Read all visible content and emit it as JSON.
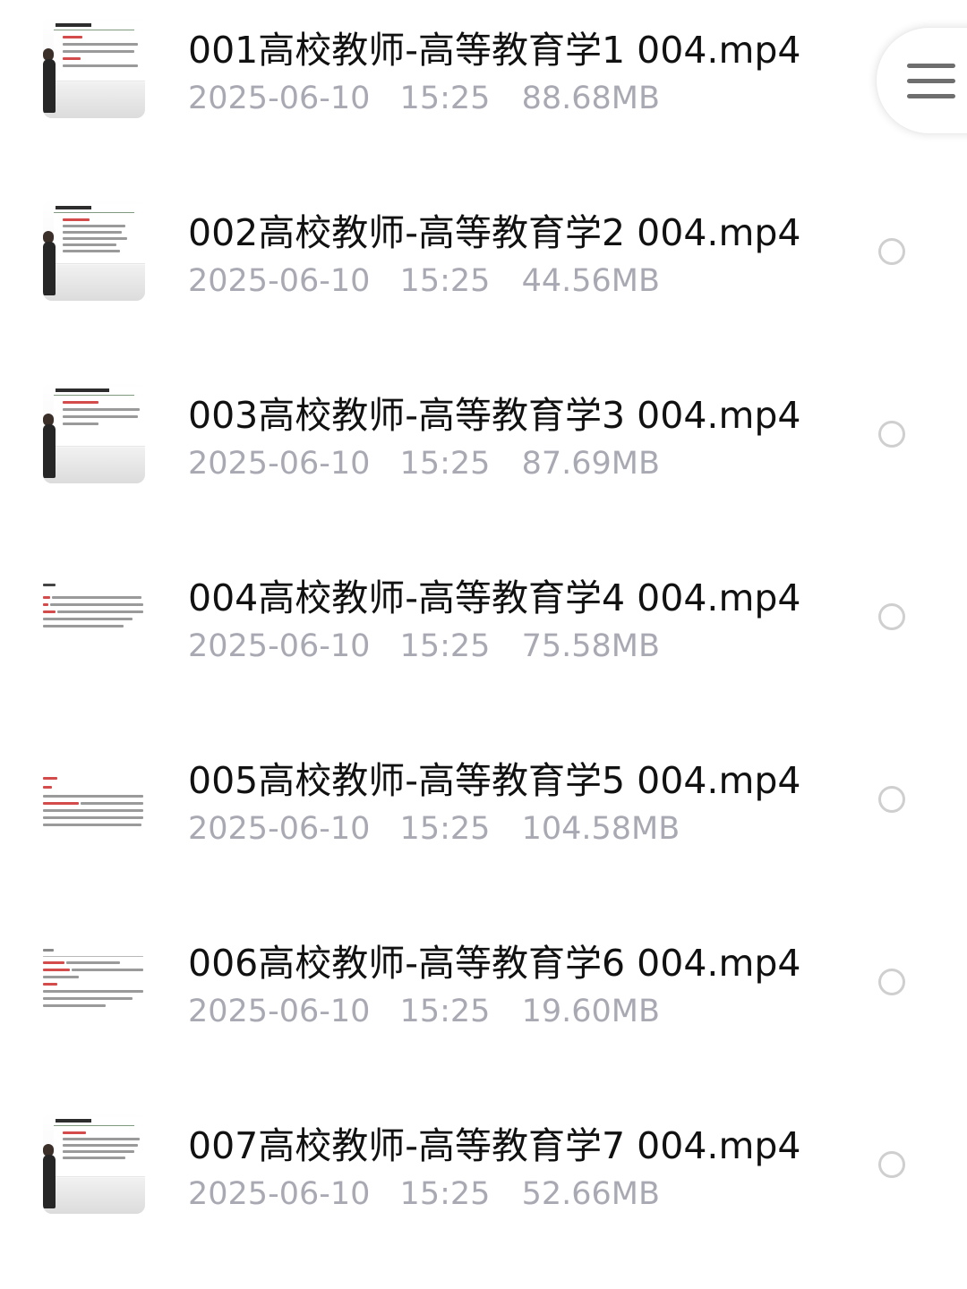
{
  "files": [
    {
      "name": "001高校教师-高等教育学1 004.mp4",
      "date": "2025-06-10",
      "time": "15:25",
      "size": "88.68MB"
    },
    {
      "name": "002高校教师-高等教育学2 004.mp4",
      "date": "2025-06-10",
      "time": "15:25",
      "size": "44.56MB"
    },
    {
      "name": "003高校教师-高等教育学3 004.mp4",
      "date": "2025-06-10",
      "time": "15:25",
      "size": "87.69MB"
    },
    {
      "name": "004高校教师-高等教育学4 004.mp4",
      "date": "2025-06-10",
      "time": "15:25",
      "size": "75.58MB"
    },
    {
      "name": "005高校教师-高等教育学5 004.mp4",
      "date": "2025-06-10",
      "time": "15:25",
      "size": "104.58MB"
    },
    {
      "name": "006高校教师-高等教育学6 004.mp4",
      "date": "2025-06-10",
      "time": "15:25",
      "size": "19.60MB"
    },
    {
      "name": "007高校教师-高等教育学7 004.mp4",
      "date": "2025-06-10",
      "time": "15:25",
      "size": "52.66MB"
    }
  ],
  "icons": {
    "menu": "menu-lines-icon",
    "select": "radio-circle-icon",
    "thumbnail": "video-thumbnail"
  },
  "colors": {
    "name_text": "#111111",
    "meta_text": "#a9a9b3",
    "radio_border": "#cfcfcf"
  }
}
